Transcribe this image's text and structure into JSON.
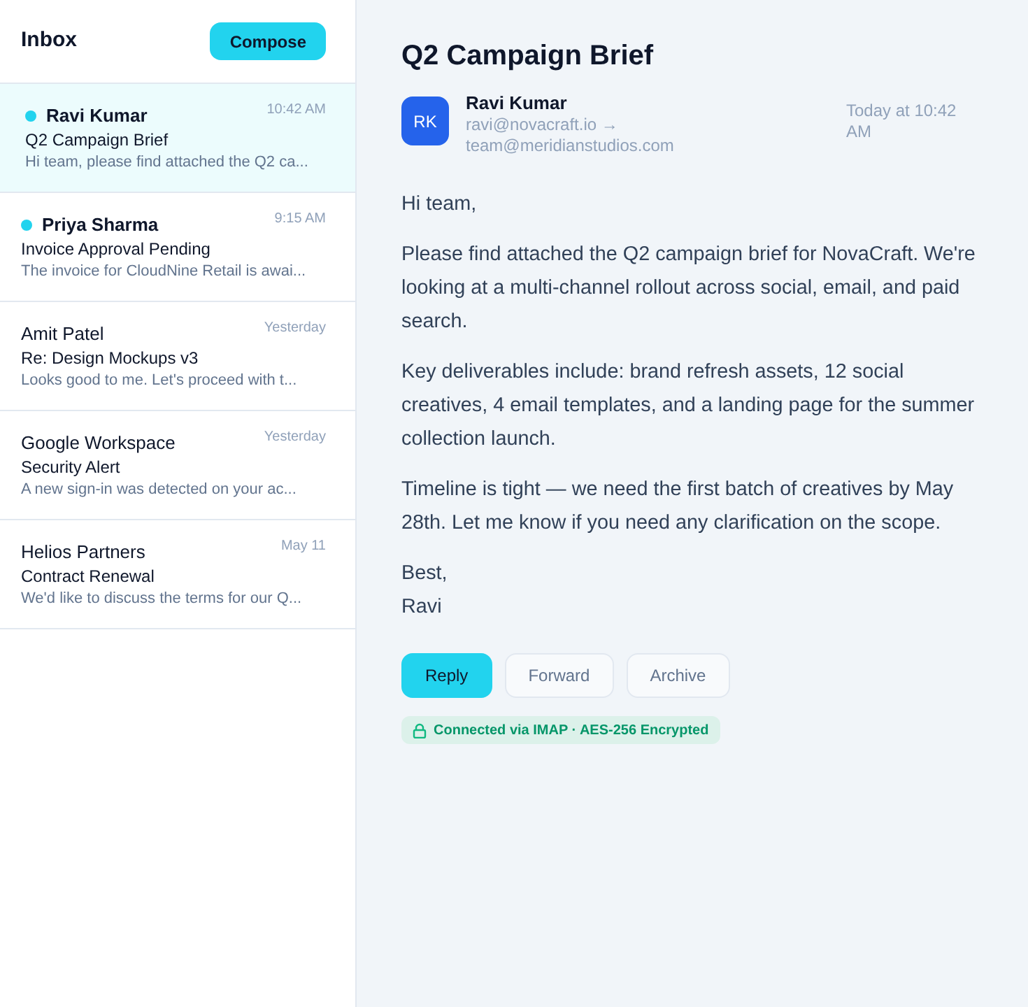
{
  "sidebar": {
    "title": "Inbox",
    "compose_button": "Compose",
    "messages": [
      {
        "sender": "Ravi Kumar",
        "time": "10:42 AM",
        "subject": "Q2 Campaign Brief",
        "preview": "Hi team, please find attached the Q2 ca...",
        "unread": true,
        "selected": true
      },
      {
        "sender": "Priya Sharma",
        "time": "9:15 AM",
        "subject": "Invoice Approval Pending",
        "preview": "The invoice for CloudNine Retail is awai...",
        "unread": true,
        "selected": false
      },
      {
        "sender": "Amit Patel",
        "time": "Yesterday",
        "subject": "Re: Design Mockups v3",
        "preview": "Looks good to me. Let's proceed with t...",
        "unread": false,
        "selected": false
      },
      {
        "sender": "Google Workspace",
        "time": "Yesterday",
        "subject": "Security Alert",
        "preview": "A new sign-in was detected on your ac...",
        "unread": false,
        "selected": false
      },
      {
        "sender": "Helios Partners",
        "time": "May 11",
        "subject": "Contract Renewal",
        "preview": "We'd like to discuss the terms for our Q...",
        "unread": false,
        "selected": false
      }
    ]
  },
  "message": {
    "subject": "Q2 Campaign Brief",
    "avatar_initials": "RK",
    "sender": "Ravi Kumar",
    "from": "ravi@novacraft.io →",
    "to": "team@meridianstudios.com",
    "date": "Today at 10:42 AM",
    "body": [
      "Hi team,",
      "Please find attached the Q2 campaign brief for NovaCraft. We're looking at a multi-channel rollout across social, email, and paid search.",
      "Key deliverables include: brand refresh assets, 12 social creatives, 4 email templates, and a landing page for the summer collection launch.",
      "Timeline is tight — we need the first batch of creatives by May 28th. Let me know if you need any clarification on the scope.",
      "Best,\nRavi"
    ]
  },
  "actions": [
    {
      "label": "Reply",
      "kind": "primary"
    },
    {
      "label": "Forward",
      "kind": "secondary"
    },
    {
      "label": "Archive",
      "kind": "secondary"
    }
  ],
  "security_badge": "Connected via IMAP · AES-256 Encrypted"
}
